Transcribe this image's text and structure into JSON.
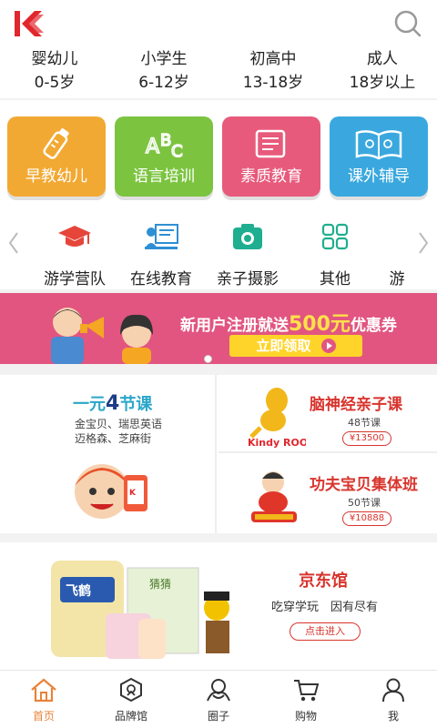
{
  "ages": [
    {
      "name": "婴幼儿",
      "range": "0-5岁"
    },
    {
      "name": "小学生",
      "range": "6-12岁"
    },
    {
      "name": "初高中",
      "range": "13-18岁"
    },
    {
      "name": "成人",
      "range": "18岁以上"
    }
  ],
  "categories": [
    {
      "label": "早教幼儿",
      "color": "#f2a933"
    },
    {
      "label": "语言培训",
      "color": "#7cc440"
    },
    {
      "label": "素质教育",
      "color": "#e75a7c"
    },
    {
      "label": "课外辅导",
      "color": "#3aa8df"
    }
  ],
  "icon_row": [
    {
      "label": "游学营队",
      "icon": "graduation-cap-icon"
    },
    {
      "label": "在线教育",
      "icon": "online-teacher-icon"
    },
    {
      "label": "亲子摄影",
      "icon": "camera-icon"
    },
    {
      "label": "其他",
      "icon": "grid-icon"
    },
    {
      "label": "游",
      "icon": ""
    }
  ],
  "banner": {
    "text_prefix": "新用户注册就送",
    "amount": "500元",
    "text_suffix": "优惠券",
    "button": "立即领取"
  },
  "promo": {
    "left_title_prefix": "一元",
    "left_title_num": "4",
    "left_title_suffix": "节课",
    "left_sub1": "金宝贝、瑞思英语",
    "left_sub2": "迈格森、芝麻街",
    "items": [
      {
        "title": "脑神经亲子课",
        "lessons": "48节课",
        "price": "¥13500",
        "brand": "Kindy ROO"
      },
      {
        "title": "功夫宝贝集体班",
        "lessons": "50节课",
        "price": "¥10888"
      }
    ]
  },
  "jd": {
    "title": "京东馆",
    "subtitle": "吃穿学玩　因有尽有",
    "button": "点击进入"
  },
  "tabs": [
    {
      "label": "首页",
      "icon": "home-icon",
      "active": true
    },
    {
      "label": "品牌馆",
      "icon": "brand-icon",
      "active": false
    },
    {
      "label": "圈子",
      "icon": "circle-icon",
      "active": false
    },
    {
      "label": "购物",
      "icon": "cart-icon",
      "active": false
    },
    {
      "label": "我",
      "icon": "user-icon",
      "active": false
    }
  ],
  "colors": {
    "accent": "#e8833a",
    "brand_red": "#e1262d",
    "banner_bg": "#e25580"
  }
}
